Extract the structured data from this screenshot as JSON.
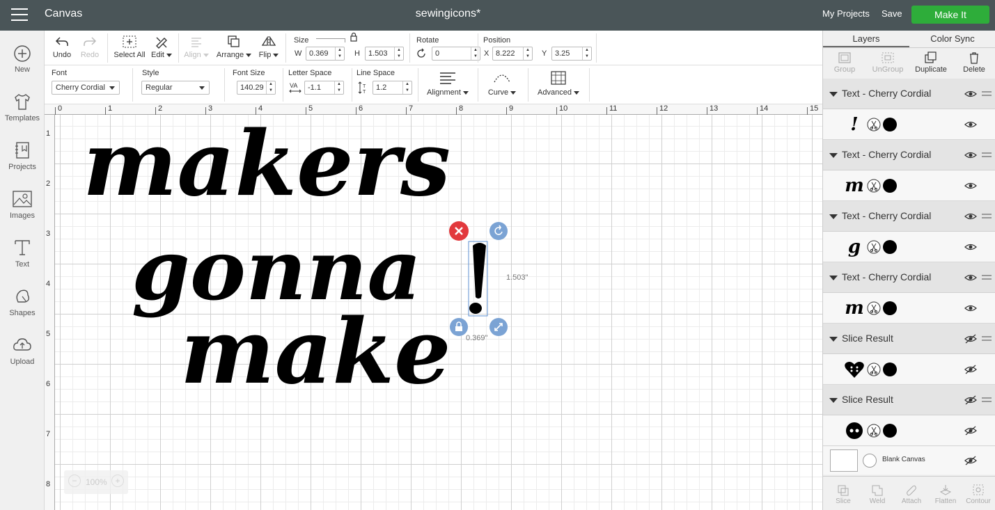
{
  "topbar": {
    "app_title": "Canvas",
    "project_title": "sewingicons*",
    "my_projects": "My Projects",
    "save": "Save",
    "make_it": "Make It"
  },
  "sidebar": {
    "items": [
      {
        "label": "New",
        "icon": "plus-circle-icon"
      },
      {
        "label": "Templates",
        "icon": "tshirt-icon"
      },
      {
        "label": "Projects",
        "icon": "notebook-icon"
      },
      {
        "label": "Images",
        "icon": "image-icon"
      },
      {
        "label": "Text",
        "icon": "text-icon"
      },
      {
        "label": "Shapes",
        "icon": "shapes-icon"
      },
      {
        "label": "Upload",
        "icon": "cloud-upload-icon"
      }
    ]
  },
  "toolbar1": {
    "undo": "Undo",
    "redo": "Redo",
    "select_all": "Select All",
    "edit": "Edit",
    "align": "Align",
    "arrange": "Arrange",
    "flip": "Flip",
    "size_label": "Size",
    "w_label": "W",
    "w_value": "0.369",
    "h_label": "H",
    "h_value": "1.503",
    "rotate_label": "Rotate",
    "rotate_value": "0",
    "position_label": "Position",
    "x_label": "X",
    "x_value": "8.222",
    "y_label": "Y",
    "y_value": "3.25"
  },
  "toolbar2": {
    "font_label": "Font",
    "font_value": "Cherry Cordial",
    "style_label": "Style",
    "style_value": "Regular",
    "font_size_label": "Font Size",
    "font_size_value": "140.29",
    "letter_space_label": "Letter Space",
    "letter_space_value": "-1.1",
    "line_space_label": "Line Space",
    "line_space_value": "1.2",
    "alignment": "Alignment",
    "curve": "Curve",
    "advanced": "Advanced"
  },
  "canvas": {
    "ruler_x": [
      "0",
      "1",
      "2",
      "3",
      "4",
      "5",
      "6",
      "7",
      "8",
      "9",
      "10",
      "11",
      "12",
      "13",
      "14",
      "15"
    ],
    "ruler_y": [
      "1",
      "2",
      "3",
      "4",
      "5",
      "6",
      "7",
      "8"
    ],
    "text_line1": "makers",
    "text_line2": "gonna",
    "text_line3": "make",
    "selected_glyph": "!",
    "height_readout": "1.503\"",
    "width_readout": "0.369\"",
    "zoom": "100%"
  },
  "layers_panel": {
    "tab_layers": "Layers",
    "tab_color_sync": "Color Sync",
    "actions": [
      "Group",
      "UnGroup",
      "Duplicate",
      "Delete"
    ],
    "layers": [
      {
        "title": "Text - Cherry Cordial",
        "thumb": "!",
        "visible": true
      },
      {
        "title": "Text - Cherry Cordial",
        "thumb": "m",
        "visible": true
      },
      {
        "title": "Text - Cherry Cordial",
        "thumb": "g",
        "visible": true
      },
      {
        "title": "Text - Cherry Cordial",
        "thumb": "m",
        "visible": true
      },
      {
        "title": "Slice Result",
        "thumb": "heart",
        "visible": false
      },
      {
        "title": "Slice Result",
        "thumb": "button",
        "visible": false
      }
    ],
    "blank_canvas": "Blank Canvas",
    "bottom_actions": [
      "Slice",
      "Weld",
      "Attach",
      "Flatten",
      "Contour"
    ]
  }
}
